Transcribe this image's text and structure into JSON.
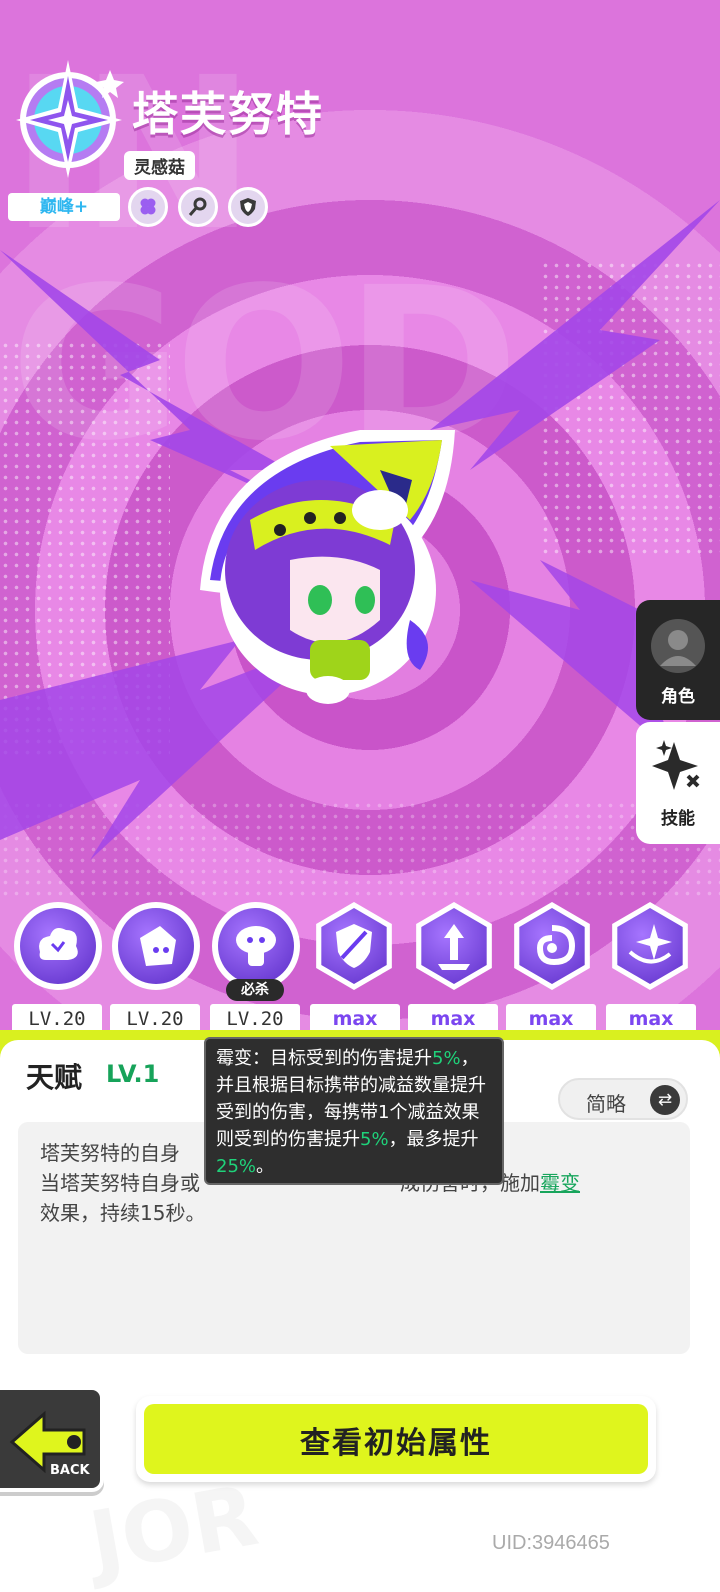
{
  "character": {
    "name": "塔芙努特",
    "subtitle": "灵感菇",
    "tier": "巅峰+",
    "badges": [
      "clover-icon",
      "key-icon",
      "shield-icon"
    ],
    "watermark": "IN GOD"
  },
  "side_tabs": [
    {
      "label": "角色",
      "icon": "avatar-icon",
      "active": false
    },
    {
      "label": "技能",
      "icon": "sparkle-icon",
      "active": true
    }
  ],
  "skills": [
    {
      "level": "LV.20"
    },
    {
      "level": "LV.20"
    },
    {
      "level": "LV.20",
      "tag": "必杀"
    },
    {
      "level": "max"
    },
    {
      "level": "max"
    },
    {
      "level": "max"
    },
    {
      "level": "max"
    }
  ],
  "talent": {
    "title": "天赋",
    "level": "LV.1",
    "mode_label": "简略",
    "description_line1": "塔芙努特的自身",
    "description_line2_a": "当塔芙努特自身或",
    "description_line2_b": "成伤害时，施加",
    "keyword": "霉变",
    "description_tail": "效果，持续15秒。"
  },
  "tooltip": {
    "p1": "霉变：目标受到的伤害提升",
    "v1": "5%",
    "p2": "，并且根据目标携带的减益数量提升受到的伤害，每携带1个减益效果则受到的伤害提升",
    "v2": "5%",
    "p3": "，最多提升",
    "v3": "25%",
    "p4": "。"
  },
  "actions": {
    "back_label": "BACK",
    "view_initial_stats": "查看初始属性"
  },
  "uid": "UID:3946465",
  "colors": {
    "accent_lime": "#dff51d",
    "purple": "#7b46f0",
    "highlight_green": "#1fd27a"
  }
}
